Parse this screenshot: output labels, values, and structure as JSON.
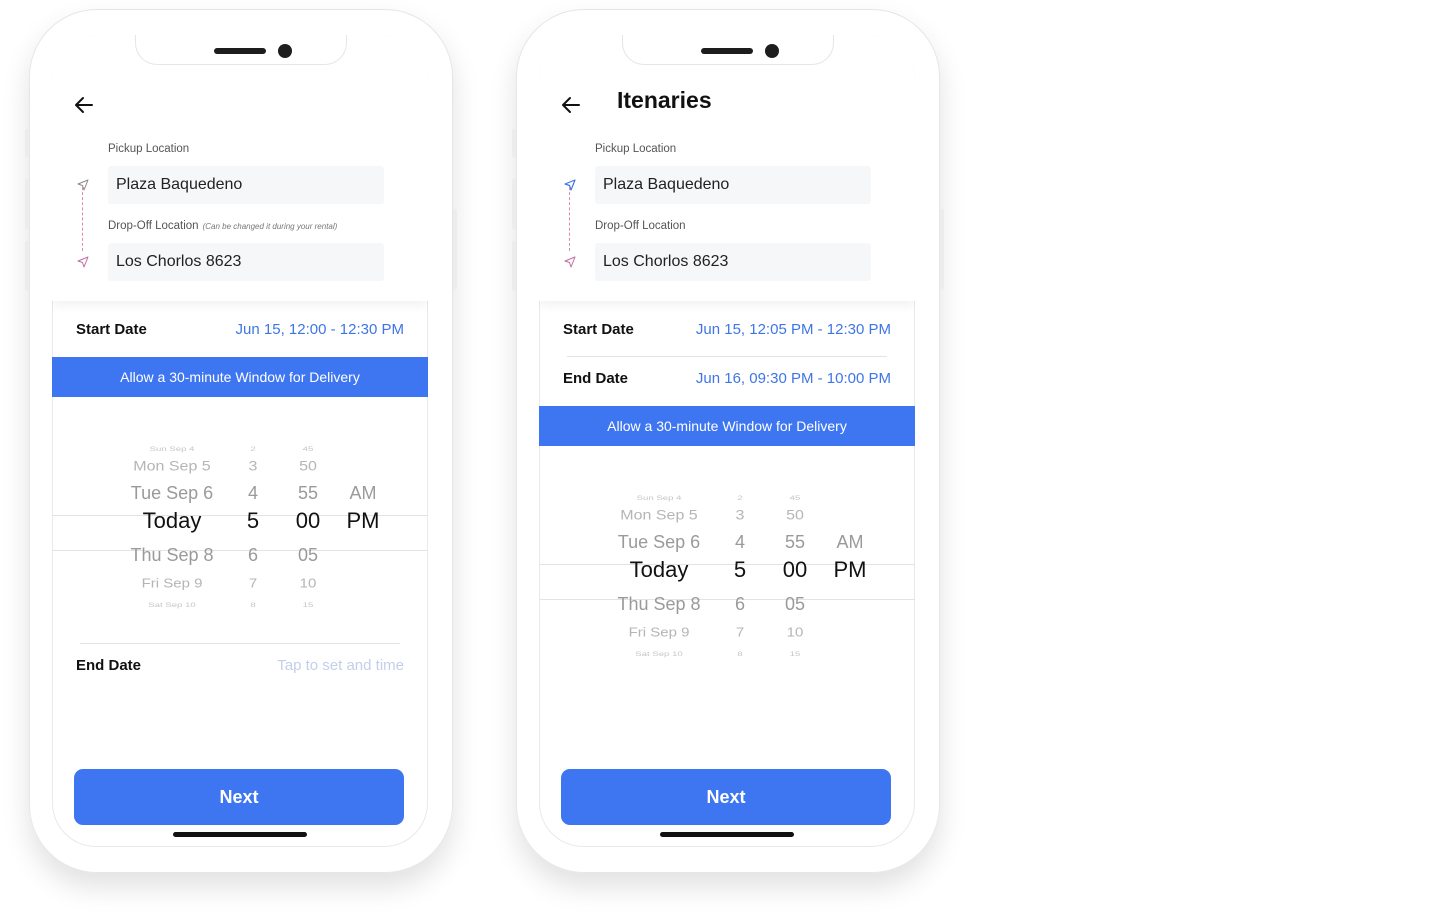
{
  "phone1": {
    "pickup_label": "Pickup Location",
    "pickup_value": "Plaza Baquedeno",
    "dropoff_label": "Drop-Off Location",
    "dropoff_hint": "(Can be changed it during your rental)",
    "dropoff_value": "Los Chorlos 8623",
    "start_label": "Start Date",
    "start_value": "Jun 15, 12:00 - 12:30 PM",
    "banner": "Allow a 30-minute Window for Delivery",
    "end_label": "End Date",
    "end_placeholder": "Tap to set and time",
    "next_label": "Next"
  },
  "phone2": {
    "title": "Itenaries",
    "pickup_label": "Pickup Location",
    "pickup_value": "Plaza Baquedeno",
    "dropoff_label": "Drop-Off Location",
    "dropoff_value": "Los Chorlos 8623",
    "start_label": "Start Date",
    "start_value": "Jun 15, 12:05 PM - 12:30 PM",
    "end_label": "End Date",
    "end_value": "Jun 16, 09:30 PM - 10:00 PM",
    "banner": "Allow a 30-minute Window for Delivery",
    "next_label": "Next"
  },
  "picker": {
    "days": [
      "Sun Sep 4",
      "Mon Sep 5",
      "Tue Sep 6",
      "Today",
      "Thu Sep 8",
      "Fri Sep 9",
      "Sat Sep 10"
    ],
    "hours": [
      "2",
      "3",
      "4",
      "5",
      "6",
      "7",
      "8"
    ],
    "minutes": [
      "45",
      "50",
      "55",
      "00",
      "05",
      "10",
      "15"
    ],
    "ampm": [
      "",
      "",
      "AM",
      "PM",
      "",
      "",
      ""
    ]
  },
  "colors": {
    "accent": "#3e76f2",
    "link_blue": "#3e76e7",
    "placeholder_blue": "#c3cfea",
    "route_dash": "#e08aa5"
  }
}
